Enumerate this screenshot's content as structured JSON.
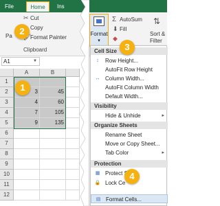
{
  "ribbon": {
    "tabs": {
      "file": "File",
      "home": "Home",
      "insert": "Ins"
    },
    "clipboard": {
      "paste": "Pa",
      "cut": "Cut",
      "copy": "Copy",
      "format_painter": "Format Painter",
      "group_label": "Clipboard"
    },
    "cells": {
      "format_label": "Format",
      "caret": "▾"
    },
    "editing": {
      "autosum": "AutoSum",
      "fill": "Fill",
      "clear": "",
      "sort_filter": "Sort &",
      "filter": "Filter"
    }
  },
  "formula_bar": {
    "name_box": "A1"
  },
  "grid": {
    "columns": [
      "A",
      "B"
    ],
    "rows": [
      {
        "num": "1",
        "a": "",
        "b": ""
      },
      {
        "num": "2",
        "a": "3",
        "b": "45"
      },
      {
        "num": "3",
        "a": "4",
        "b": "60"
      },
      {
        "num": "4",
        "a": "7",
        "b": "105"
      },
      {
        "num": "5",
        "a": "9",
        "b": "135"
      },
      {
        "num": "6",
        "a": "",
        "b": ""
      },
      {
        "num": "7",
        "a": "",
        "b": ""
      },
      {
        "num": "8",
        "a": "",
        "b": ""
      },
      {
        "num": "9",
        "a": "",
        "b": ""
      },
      {
        "num": "10",
        "a": "",
        "b": ""
      },
      {
        "num": "11",
        "a": "",
        "b": ""
      },
      {
        "num": "12",
        "a": "",
        "b": ""
      }
    ]
  },
  "menu": {
    "cell_size": "Cell Size",
    "row_height": "Row Height...",
    "autofit_row": "AutoFit Row Height",
    "column_width": "Column Width...",
    "autofit_column": "AutoFit Column Width",
    "default_width": "Default Width...",
    "visibility": "Visibility",
    "hide_unhide": "Hide & Unhide",
    "organize": "Organize Sheets",
    "rename": "Rename Sheet",
    "move_copy": "Move or Copy Sheet...",
    "tab_color": "Tab Color",
    "protection": "Protection",
    "protect_sheet": "Protect S",
    "lock_cell": "Lock Ce",
    "format_cells": "Format Cells..."
  },
  "badges": [
    "1",
    "2",
    "3",
    "4"
  ],
  "colors": {
    "excel_green": "#217346",
    "badge_orange": "#f5b10f",
    "highlight": "#dbe8f3"
  }
}
